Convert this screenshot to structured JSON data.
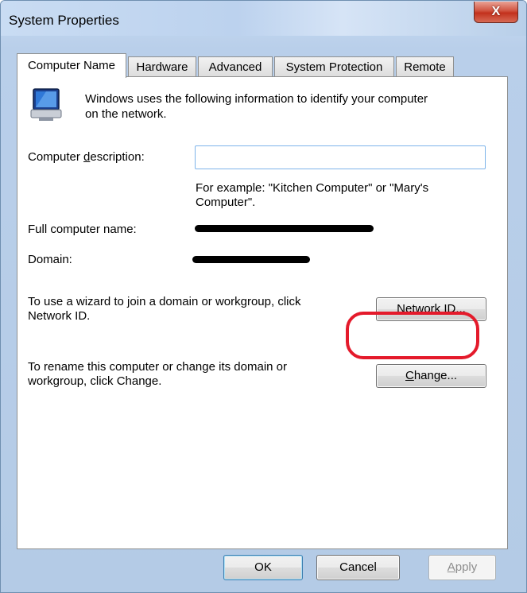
{
  "window": {
    "title": "System Properties",
    "close_label": "X"
  },
  "tabs": [
    {
      "label": "Computer Name",
      "active": true
    },
    {
      "label": "Hardware"
    },
    {
      "label": "Advanced"
    },
    {
      "label": "System Protection"
    },
    {
      "label": "Remote"
    }
  ],
  "computer_name": {
    "intro_line1": "Windows uses the following information to identify your computer",
    "intro_line2": "on the network.",
    "description_label_pre": "Computer ",
    "description_label_u": "d",
    "description_label_post": "escription:",
    "description_value": "",
    "example_line1": "For example: \"Kitchen Computer\" or \"Mary's",
    "example_line2": "Computer\".",
    "full_name_label": "Full computer name:",
    "domain_label": "Domain:",
    "wizard_line1": "To use a wizard to join a domain or workgroup, click",
    "wizard_line2": "Network ID.",
    "network_id_u": "N",
    "network_id_rest": "etwork ID...",
    "rename_line1": "To rename this computer or change its domain or",
    "rename_line2": "workgroup, click Change.",
    "change_u": "C",
    "change_rest": "hange..."
  },
  "footer": {
    "ok_label": "OK",
    "cancel_label": "Cancel",
    "apply_u": "A",
    "apply_rest": "pply"
  },
  "colors": {
    "highlight": "#e41a2b",
    "title_gradient": "#bcd2ee"
  },
  "icons": {
    "computer": "computer-monitor-icon",
    "close": "close-icon"
  }
}
